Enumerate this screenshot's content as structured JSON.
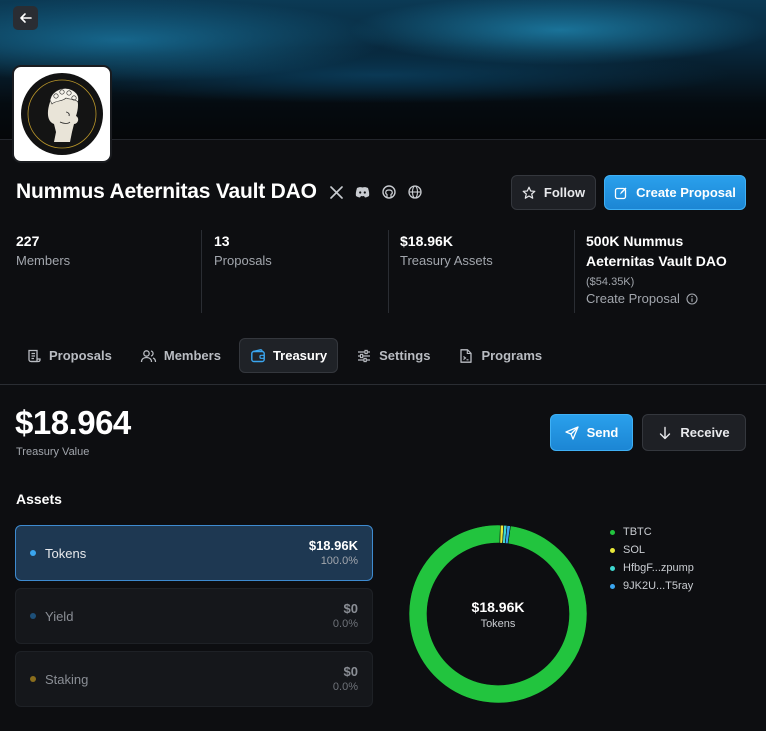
{
  "header": {
    "title": "Nummus Aeternitas Vault DAO",
    "logo_text_top": "NUMMUS AETERNITAS",
    "logo_text_bottom": "VAULT DAO",
    "follow_label": "Follow",
    "create_proposal_label": "Create Proposal",
    "socials": [
      "x-icon",
      "discord-icon",
      "github-icon",
      "globe-icon"
    ]
  },
  "stats": [
    {
      "value": "227",
      "label": "Members"
    },
    {
      "value": "13",
      "label": "Proposals"
    },
    {
      "value": "$18.96K",
      "label": "Treasury Assets"
    }
  ],
  "governance": {
    "value_line1": "500K Nummus",
    "value_line2": "Aeternitas Vault DAO",
    "usd": "($54.35K)",
    "link": "Create Proposal"
  },
  "tabs": [
    {
      "label": "Proposals",
      "icon": "scroll-icon"
    },
    {
      "label": "Members",
      "icon": "users-icon"
    },
    {
      "label": "Treasury",
      "icon": "wallet-icon",
      "active": true
    },
    {
      "label": "Settings",
      "icon": "sliders-icon"
    },
    {
      "label": "Programs",
      "icon": "terminal-file-icon"
    }
  ],
  "treasury": {
    "value": "$18.964",
    "label": "Treasury Value",
    "send_label": "Send",
    "receive_label": "Receive"
  },
  "assets": {
    "title": "Assets",
    "items": [
      {
        "name": "Tokens",
        "value": "$18.96K",
        "pct": "100.0%",
        "color": "#3aa6f0",
        "active": true
      },
      {
        "name": "Yield",
        "value": "$0",
        "pct": "0.0%",
        "color": "#1d4f78",
        "active": false
      },
      {
        "name": "Staking",
        "value": "$0",
        "pct": "0.0%",
        "color": "#8a6d1c",
        "active": false
      }
    ]
  },
  "chart_data": {
    "type": "pie",
    "center_value": "$18.96K",
    "center_label": "Tokens",
    "series": [
      {
        "name": "TBTC",
        "value": 98.2,
        "color": "#22c43e"
      },
      {
        "name": "SOL",
        "value": 0.6,
        "color": "#e8e83a"
      },
      {
        "name": "HfbgF...zpump",
        "value": 0.6,
        "color": "#3ed8d0"
      },
      {
        "name": "9JK2U...T5ray",
        "value": 0.6,
        "color": "#3aa6f0"
      }
    ],
    "legend": "right"
  }
}
